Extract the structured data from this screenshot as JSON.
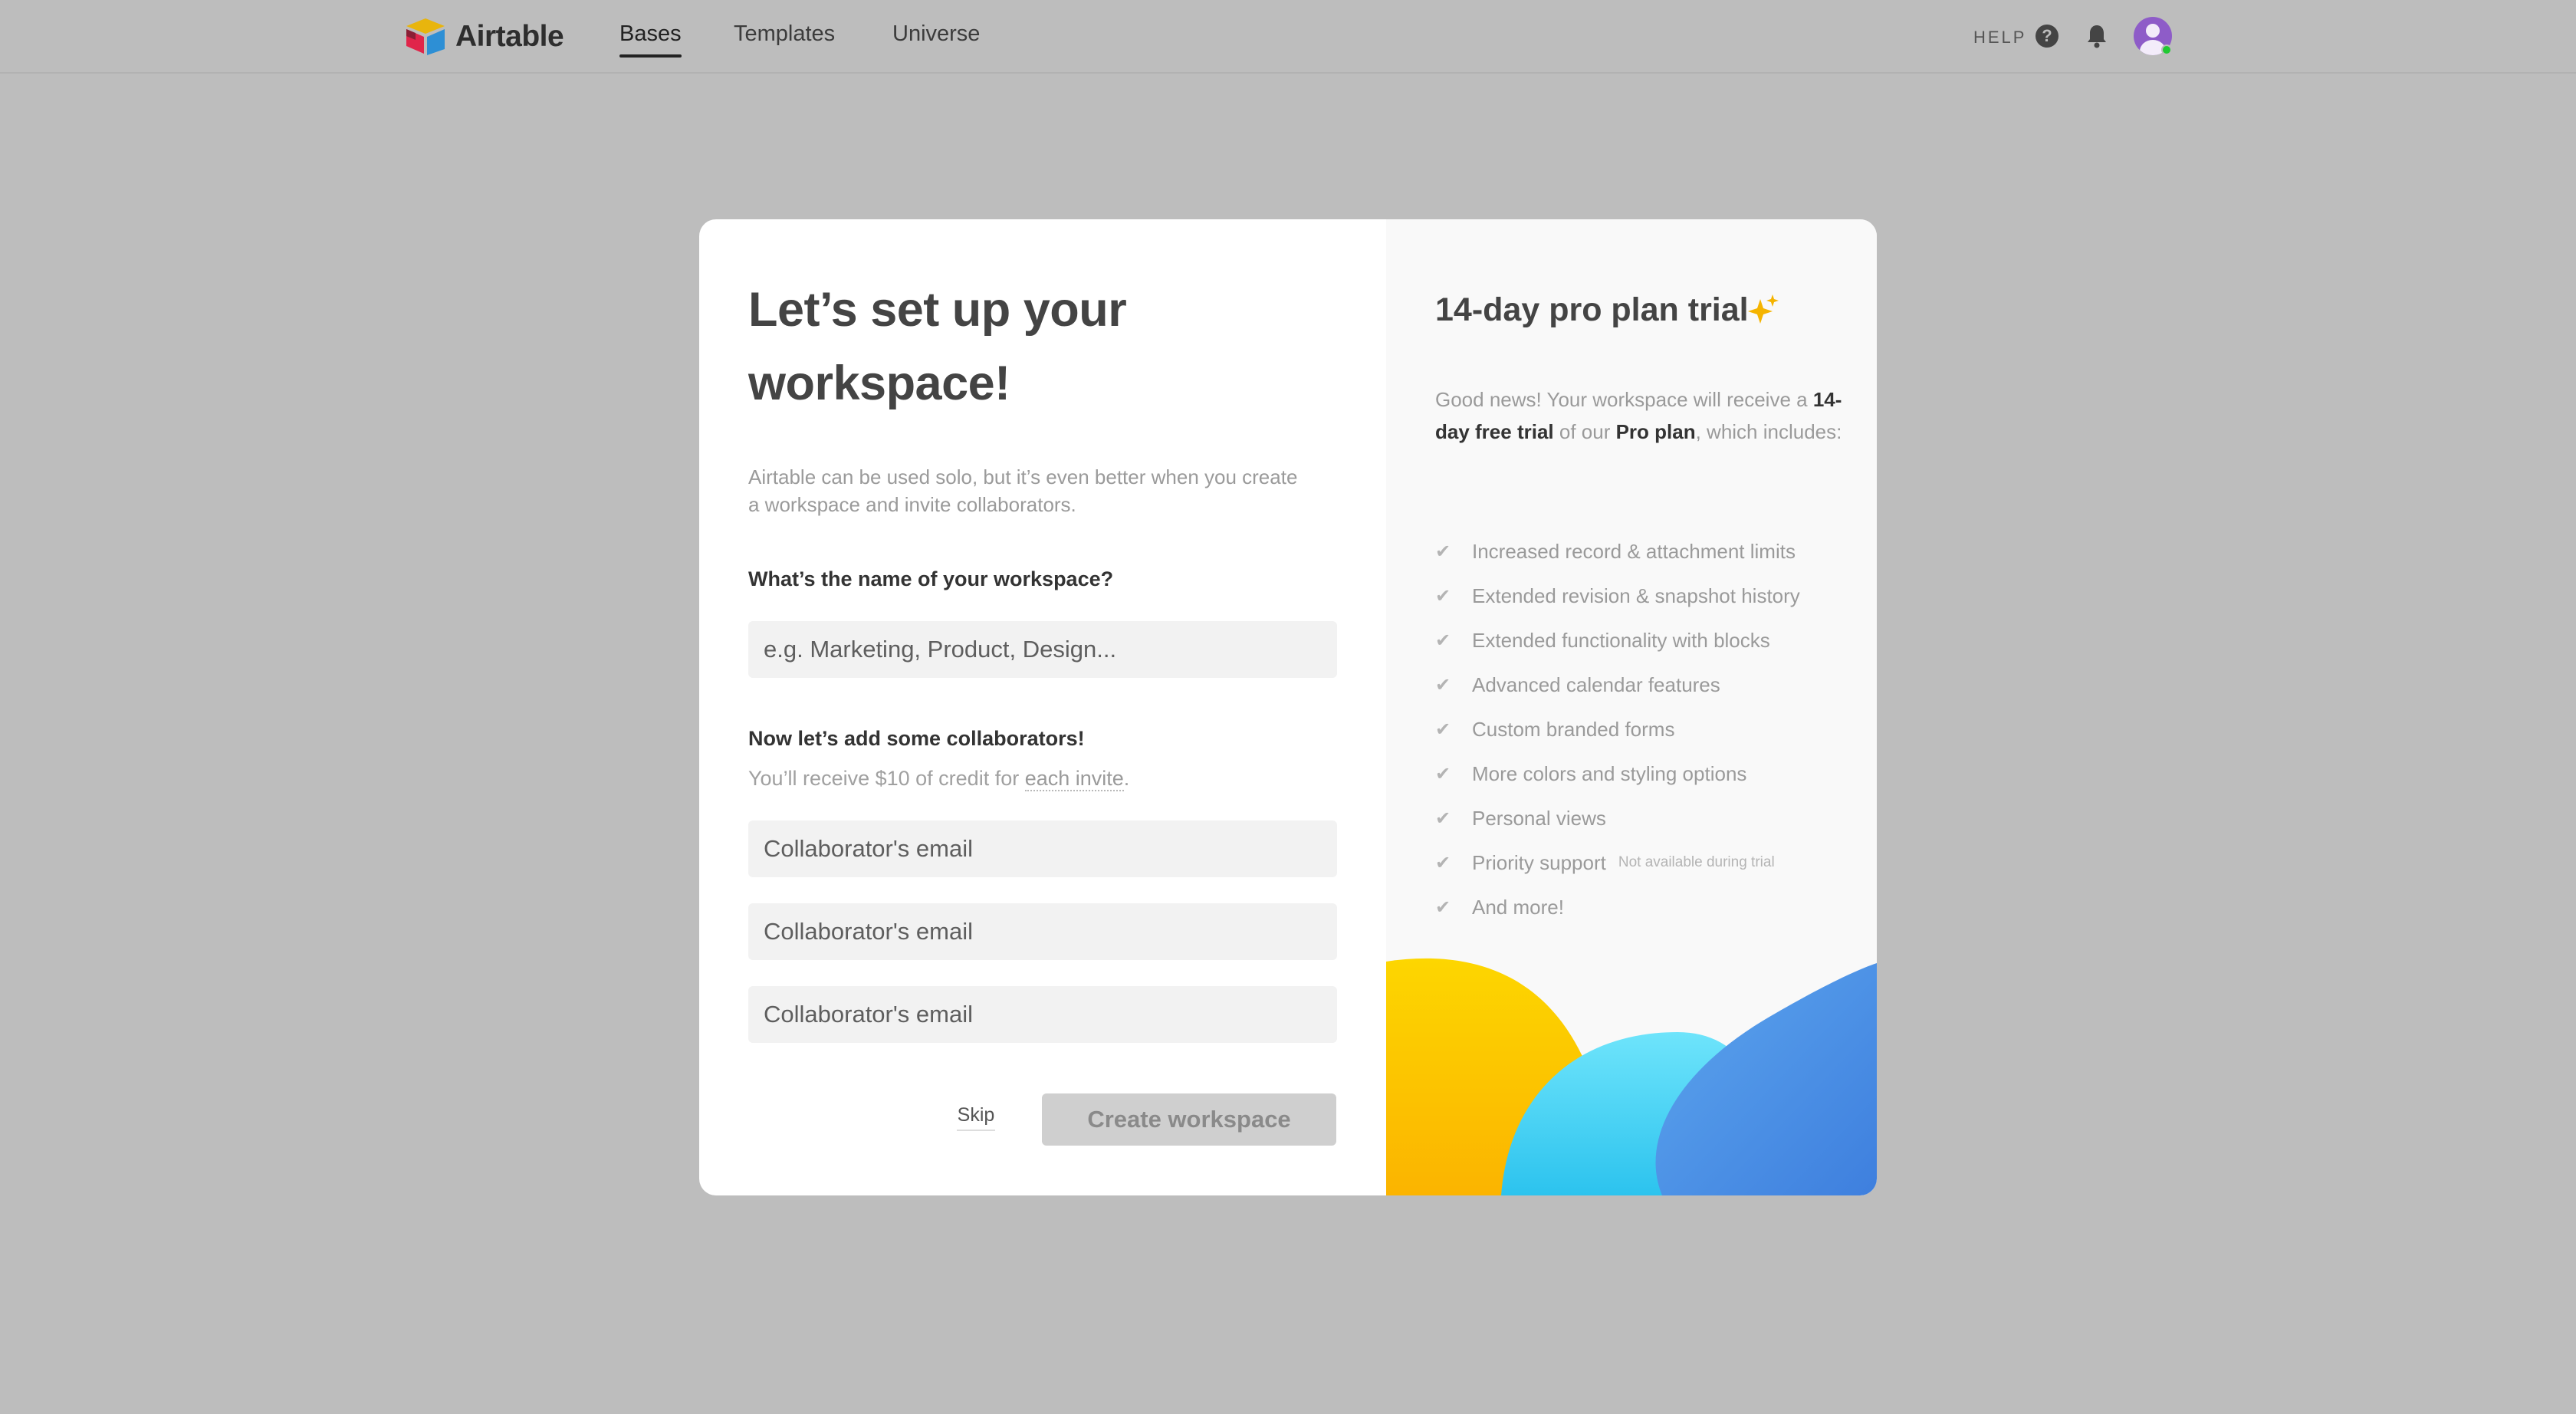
{
  "nav": {
    "brand": "Airtable",
    "tabs": [
      "Bases",
      "Templates",
      "Universe"
    ],
    "active_tab": "Bases",
    "help_label": "HELP",
    "help_icon": "?"
  },
  "modal": {
    "title_line1": "Let’s set up your",
    "title_line2": "workspace!",
    "intro": "Airtable can be used solo, but it’s even better when you create a workspace and invite collaborators.",
    "workspace_question": "What’s the name of your workspace?",
    "workspace_placeholder": "e.g. Marketing, Product, Design...",
    "collaborators_heading": "Now let’s add some collaborators!",
    "credit_text": "You’ll receive $10 of credit for ",
    "credit_link": "each invite",
    "credit_suffix": ".",
    "collaborator_placeholder": "Collaborator's email",
    "skip_label": "Skip",
    "create_label": "Create workspace"
  },
  "trial": {
    "title": "14-day pro plan trial",
    "intro_prefix": "Good news! Your workspace will receive a ",
    "intro_trial": "14-day free trial",
    "intro_middle": " of our ",
    "intro_plan": "Pro plan",
    "intro_suffix": ", which includes:",
    "features": [
      {
        "label": "Increased record & attachment limits",
        "note": ""
      },
      {
        "label": "Extended revision & snapshot history",
        "note": ""
      },
      {
        "label": "Extended functionality with blocks",
        "note": ""
      },
      {
        "label": "Advanced calendar features",
        "note": ""
      },
      {
        "label": "Custom branded forms",
        "note": ""
      },
      {
        "label": "More colors and styling options",
        "note": ""
      },
      {
        "label": "Personal views",
        "note": ""
      },
      {
        "label": "Priority support",
        "note": "Not available during trial"
      },
      {
        "label": "And more!",
        "note": ""
      }
    ],
    "check_icon": "✔"
  },
  "colors": {
    "backdrop": "#bdbdbd",
    "accent_yellow": "#fcc800",
    "accent_cyan": "#4fd3f7",
    "accent_blue": "#4a8de6",
    "avatar": "#8e5cc8",
    "status_online": "#20c933"
  }
}
